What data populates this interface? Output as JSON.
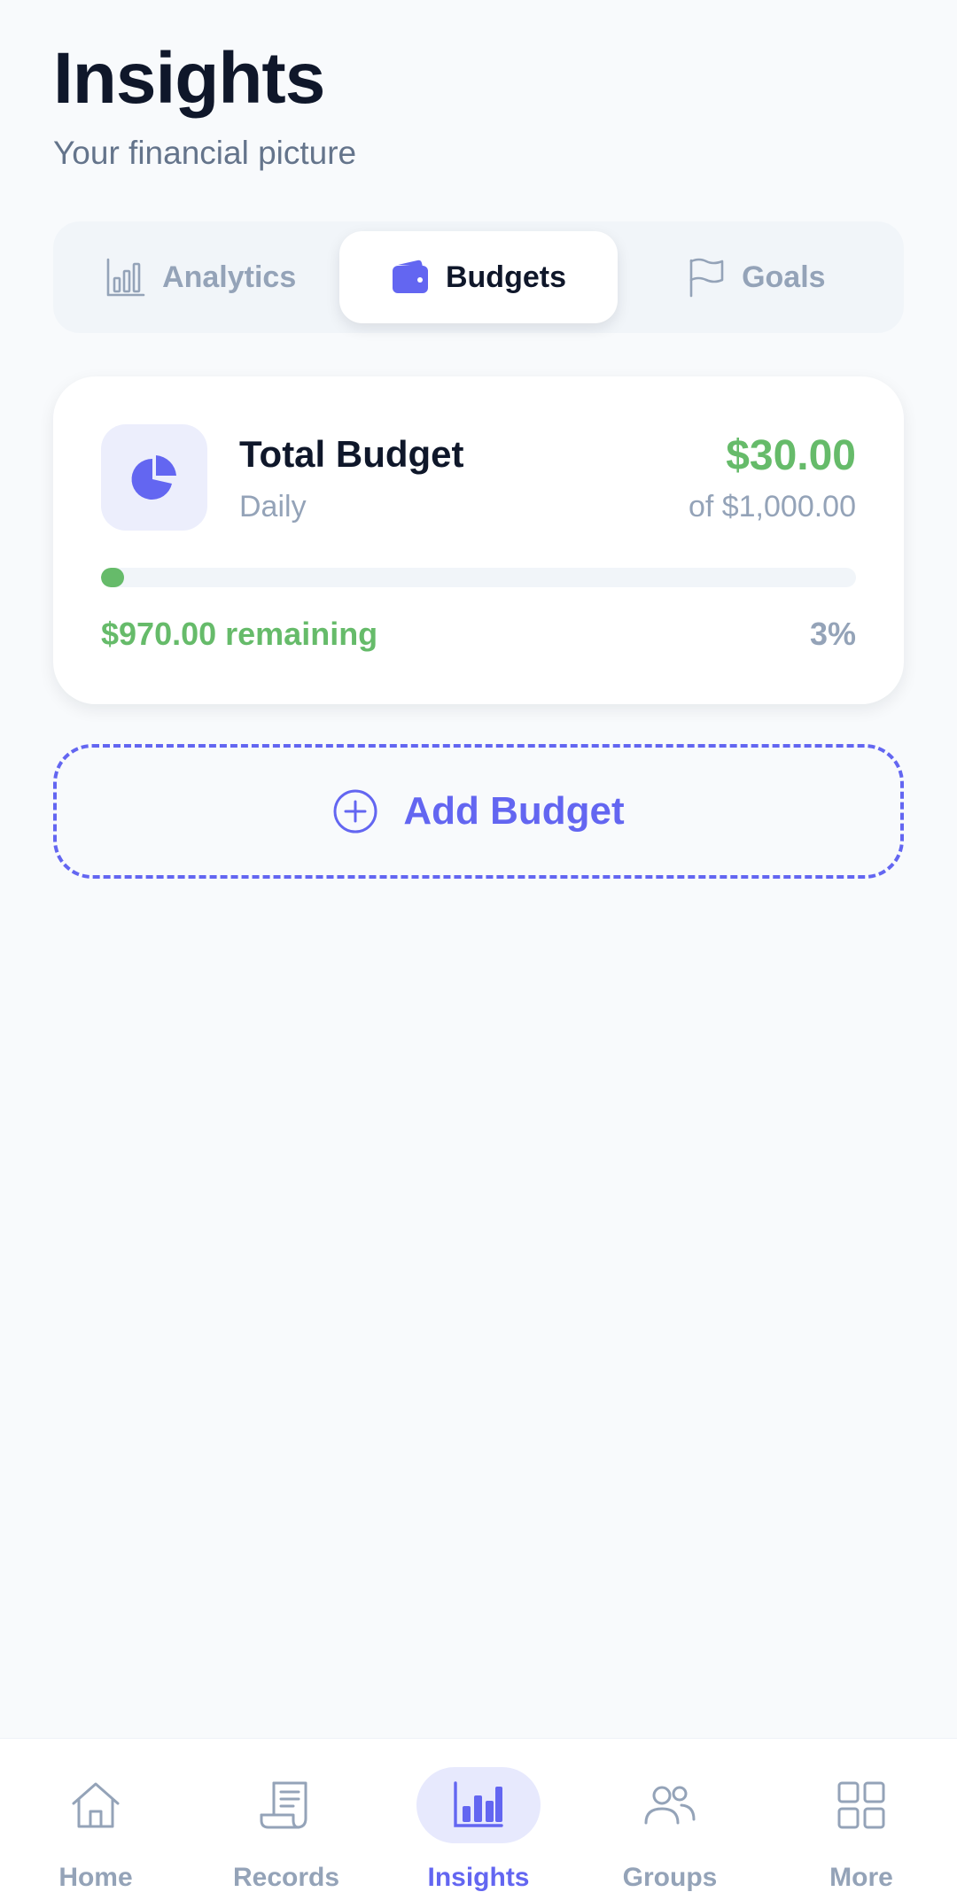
{
  "header": {
    "title": "Insights",
    "subtitle": "Your financial picture"
  },
  "tabs": [
    {
      "label": "Analytics",
      "icon": "bar-chart-icon",
      "active": false
    },
    {
      "label": "Budgets",
      "icon": "wallet-icon",
      "active": true
    },
    {
      "label": "Goals",
      "icon": "flag-icon",
      "active": false
    }
  ],
  "budget_card": {
    "icon": "pie-chart-icon",
    "title": "Total Budget",
    "period": "Daily",
    "spent": "$30.00",
    "limit": "of $1,000.00",
    "remaining": "$970.00 remaining",
    "percent": "3%",
    "progress_fraction": 0.03
  },
  "add_budget": {
    "label": "Add Budget",
    "icon": "plus-circle-icon"
  },
  "bottom_nav": [
    {
      "label": "Home",
      "icon": "home-icon",
      "active": false
    },
    {
      "label": "Records",
      "icon": "receipt-icon",
      "active": false
    },
    {
      "label": "Insights",
      "icon": "bar-chart-icon",
      "active": true
    },
    {
      "label": "Groups",
      "icon": "users-icon",
      "active": false
    },
    {
      "label": "More",
      "icon": "grid-icon",
      "active": false
    }
  ],
  "colors": {
    "accent": "#6366f1",
    "positive": "#66bb6a",
    "muted": "#94a3b8",
    "text": "#0f172a",
    "background": "#f8fafc"
  }
}
